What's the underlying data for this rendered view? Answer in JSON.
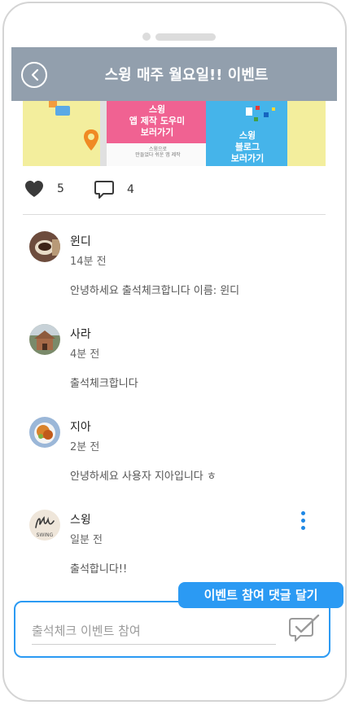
{
  "header": {
    "title": "스윙 매주 월요일!! 이벤트"
  },
  "banner": {
    "pink_text": "스윙\n앱 제작 도우미\n보러가기",
    "blue_text": "스윙\n블로그\n보러가기",
    "small_text": "스윙으로\n만들었다 쉬운 앱 제작"
  },
  "stats": {
    "likes": "5",
    "comments": "4"
  },
  "comments": [
    {
      "name": "윈디",
      "time": "14분 전",
      "text": "안녕하세요 출석체크합니다 이름: 윈디",
      "avatar": "coffee-cup"
    },
    {
      "name": "사라",
      "time": "4분 전",
      "text": "출석체크합니다",
      "avatar": "house"
    },
    {
      "name": "지아",
      "time": "2분 전",
      "text": "안녕하세요 사용자 지아입니다 ㅎ",
      "avatar": "food"
    },
    {
      "name": "스윙",
      "time": "일분 전",
      "text": "출석합니다!!",
      "avatar": "swing-logo"
    }
  ],
  "composer": {
    "placeholder": "출석체크 이벤트 참여"
  },
  "callout": {
    "label": "이벤트 참여 댓글 달기"
  },
  "colors": {
    "header": "#929fad",
    "accent": "#2b9af3",
    "more": "#1e88e5"
  }
}
